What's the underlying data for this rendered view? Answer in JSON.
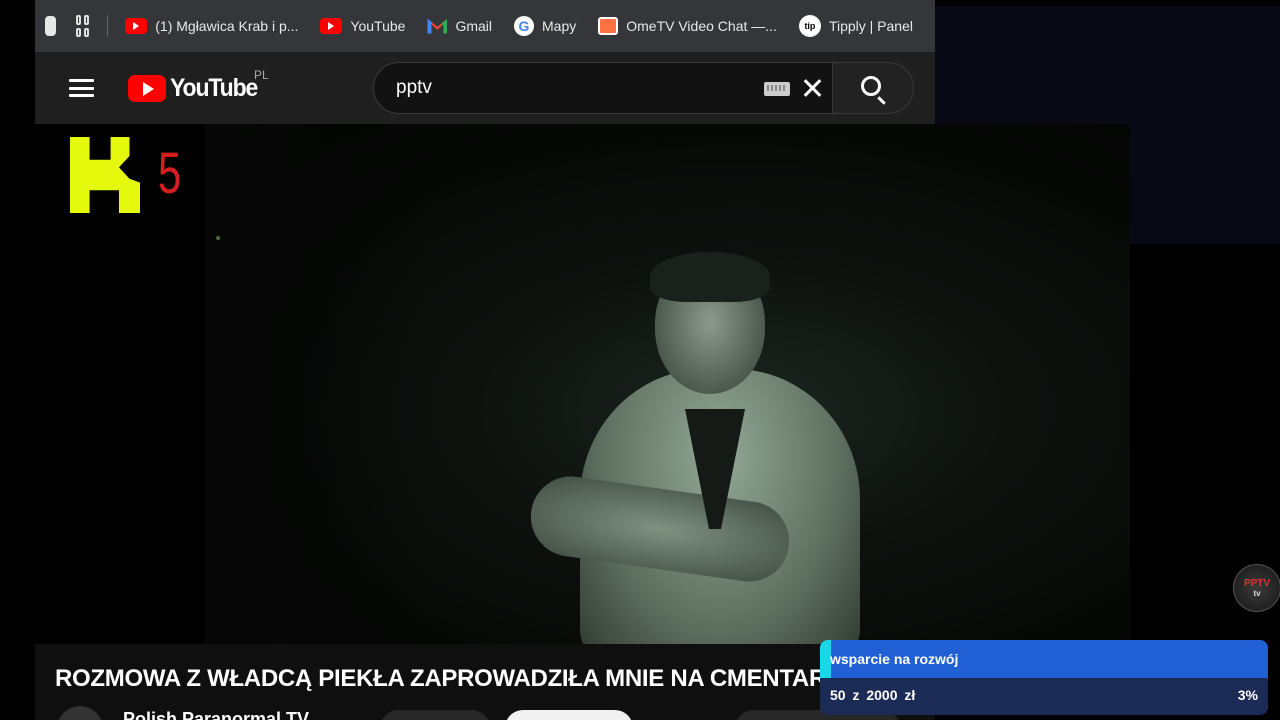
{
  "browser": {
    "bookmarks": [
      {
        "label": "(1) Mgławica Krab i p...",
        "icon": "youtube-icon"
      },
      {
        "label": "YouTube",
        "icon": "youtube-icon"
      },
      {
        "label": "Gmail",
        "icon": "gmail-icon"
      },
      {
        "label": "Mapy",
        "icon": "google-icon"
      },
      {
        "label": "OmeTV Video Chat —...",
        "icon": "ometv-icon"
      },
      {
        "label": "Tipply | Panel",
        "icon": "tipply-icon"
      }
    ],
    "tipply_icon_text": "tip",
    "google_icon_text": "G"
  },
  "youtube": {
    "logo_text": "YouTube",
    "country_code": "PL",
    "search_value": "pptv",
    "video_title": "ROZMOWA Z WŁADCĄ PIEKŁA ZAPROWADZIŁA MNIE NA CMENTARZ...",
    "channel_name": "Polish Paranormal TV",
    "watermark_top": "PPTV",
    "watermark_bottom": "tv"
  },
  "overlay": {
    "k5_digit": "5",
    "goal": {
      "title": "wsparcie na rozwój",
      "amount": "50 z 2000 zł",
      "percent_text": "3%",
      "progress": 0.025,
      "colors": {
        "header": "#2060d4",
        "progress": "#18d8e8",
        "body": "#1c2b55"
      }
    }
  },
  "colors": {
    "youtube_red": "#ff0000",
    "k5_yellow": "#e4f90c",
    "k5_red": "#d51f1f"
  }
}
